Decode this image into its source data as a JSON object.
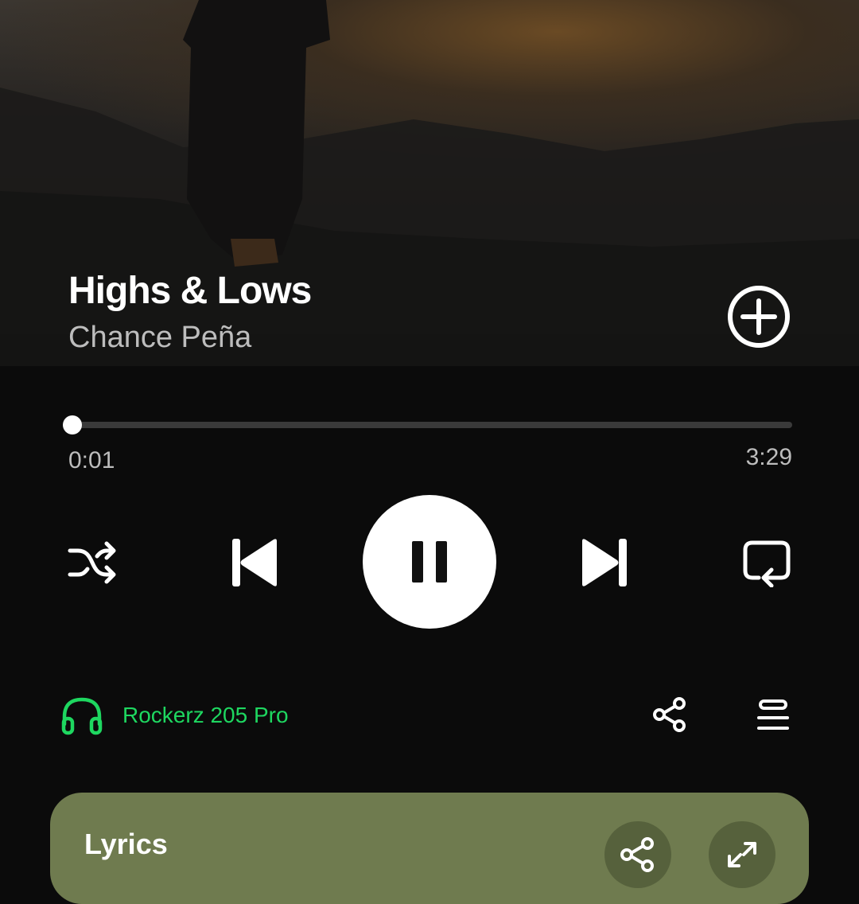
{
  "track": {
    "title": "Highs & Lows",
    "artist": "Chance Peña"
  },
  "playback": {
    "elapsed": "0:01",
    "total": "3:29",
    "progress_fraction": 0.005,
    "state": "playing"
  },
  "device": {
    "name": "Rockerz 205 Pro",
    "icon": "headphones-icon",
    "color": "#1ed760"
  },
  "lyrics": {
    "heading": "Lyrics",
    "card_color": "#6f7b4f"
  },
  "icons": {
    "add": "plus-circle-icon",
    "shuffle": "shuffle-icon",
    "previous": "skip-back-icon",
    "pause": "pause-icon",
    "next": "skip-forward-icon",
    "repeat": "repeat-icon",
    "share": "share-icon",
    "queue": "queue-icon",
    "expand": "expand-icon"
  }
}
